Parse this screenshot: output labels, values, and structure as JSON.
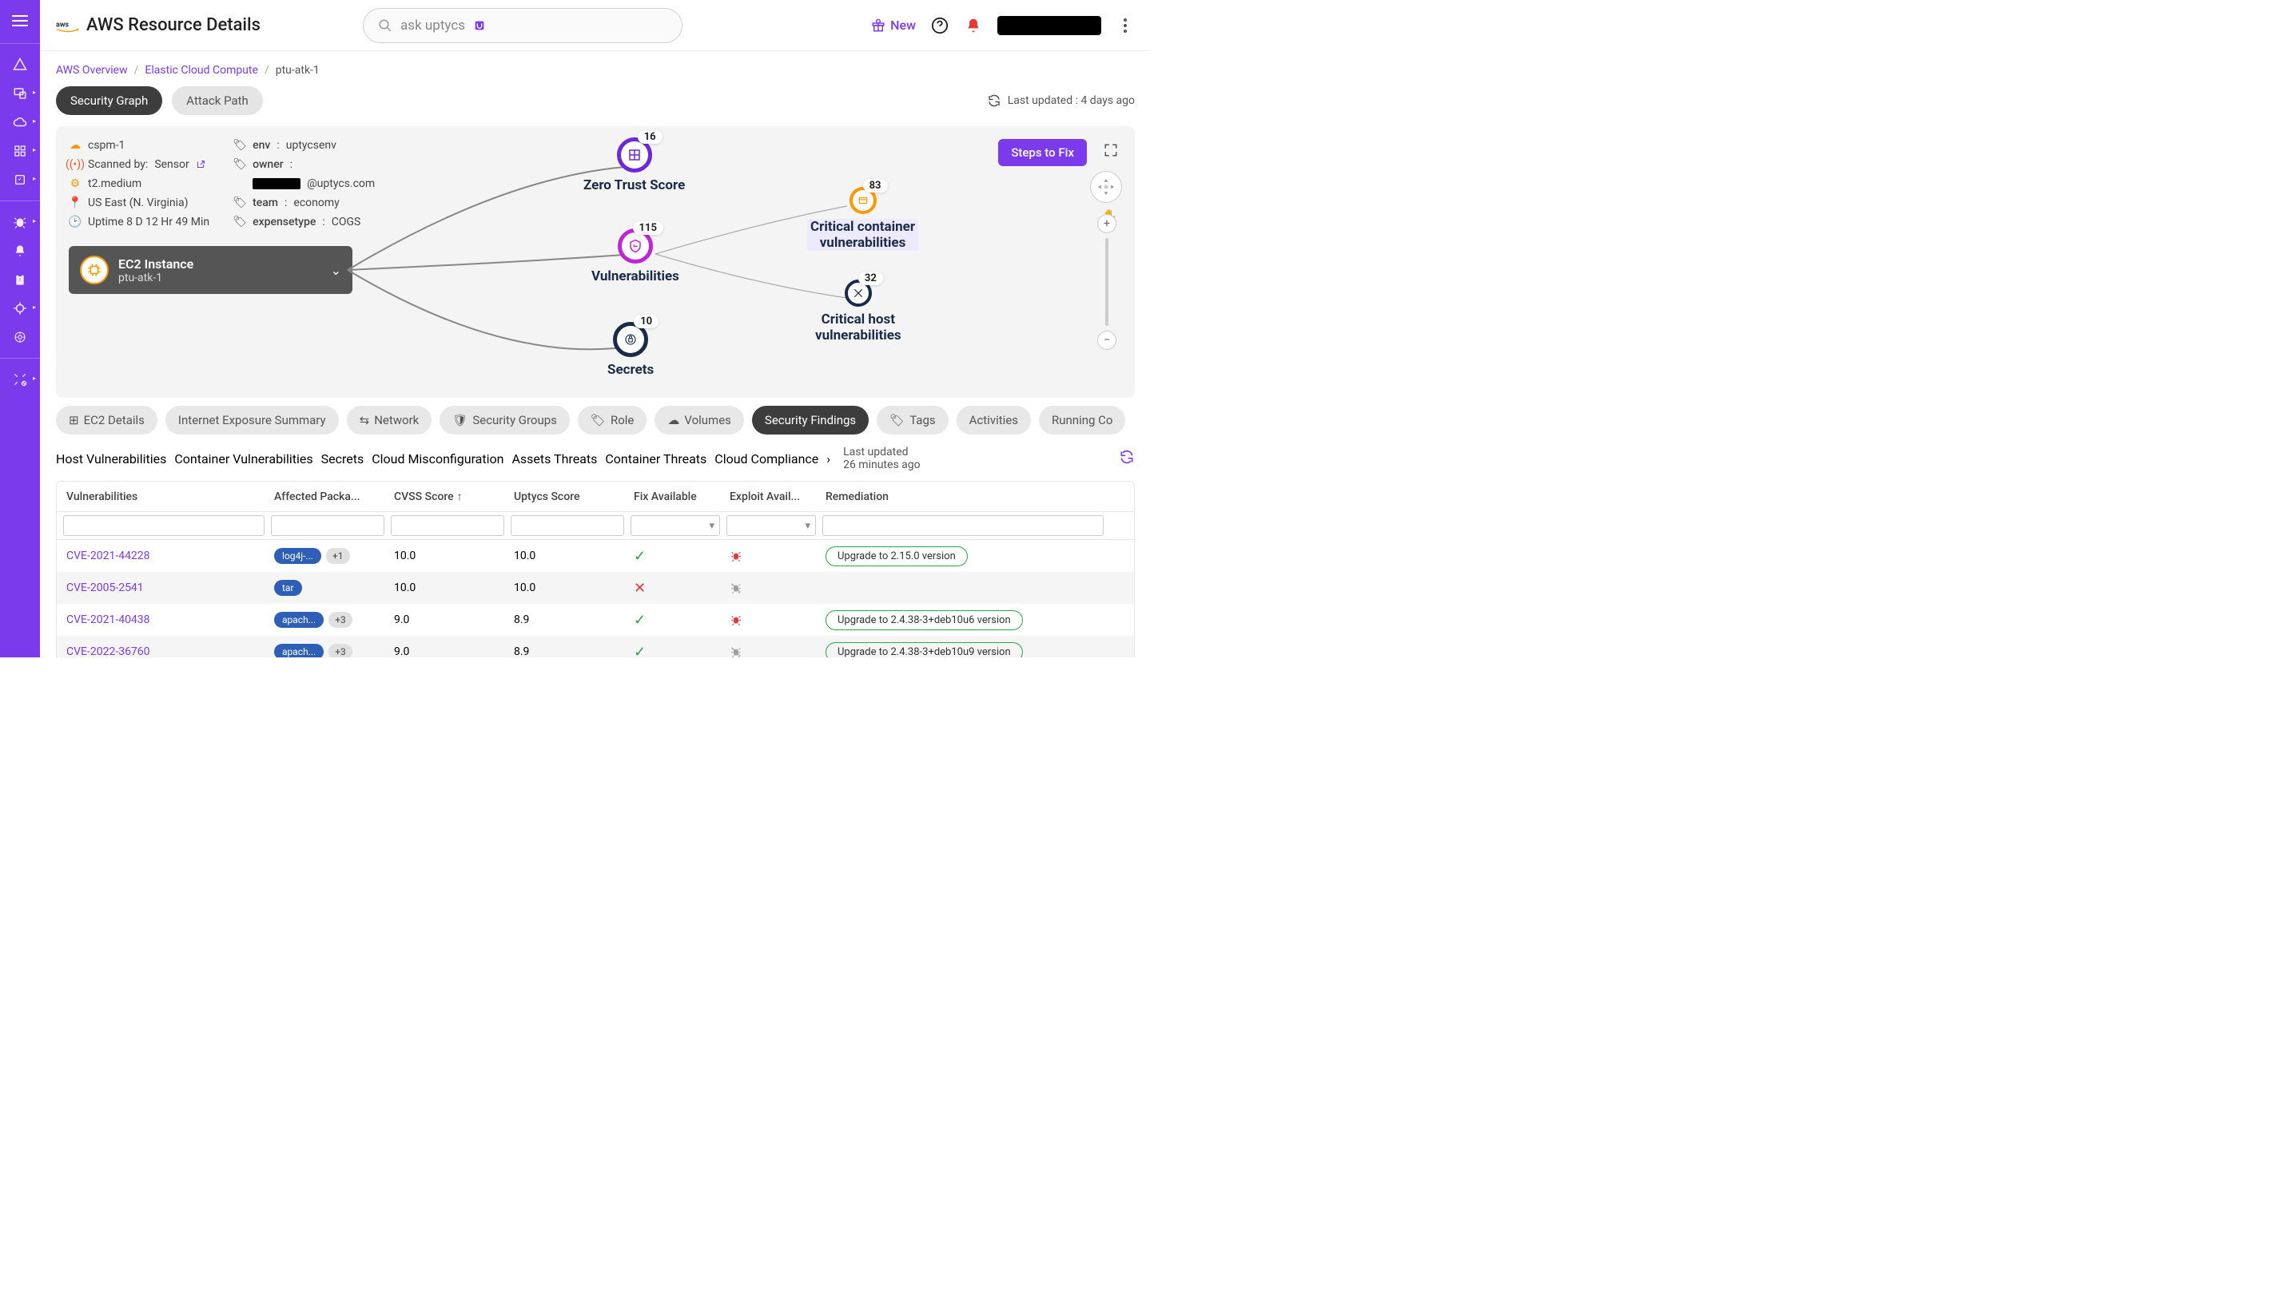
{
  "header": {
    "page_title": "AWS Resource Details",
    "search_placeholder": "ask uptycs",
    "new_label": "New"
  },
  "breadcrumb": {
    "root": "AWS Overview",
    "mid": "Elastic Cloud Compute",
    "current": "ptu-atk-1"
  },
  "view_tabs": {
    "security_graph": "Security Graph",
    "attack_path": "Attack Path"
  },
  "last_updated": "Last updated : 4 days ago",
  "meta": {
    "account": "cspm-1",
    "scanned_by_label": "Scanned by:",
    "scanned_by": "Sensor",
    "instance_type": "t2.medium",
    "region": "US East (N. Virginia)",
    "uptime": "Uptime 8 D 12 Hr 49 Min",
    "tags": {
      "env_k": "env",
      "env_v": "uptycsenv",
      "owner_k": "owner",
      "owner_suffix": "@uptycs.com",
      "team_k": "team",
      "team_v": "economy",
      "exp_k": "expensetype",
      "exp_v": "COGS"
    }
  },
  "ec2_card": {
    "type": "EC2 Instance",
    "name": "ptu-atk-1"
  },
  "steps_btn": "Steps to Fix",
  "graph": {
    "zero_trust": {
      "label": "Zero Trust Score",
      "count": "16"
    },
    "vulns": {
      "label": "Vulnerabilities",
      "count": "115"
    },
    "secrets": {
      "label": "Secrets",
      "count": "10"
    },
    "crit_container": {
      "label1": "Critical container",
      "label2": "vulnerabilities",
      "count": "83"
    },
    "crit_host": {
      "label1": "Critical host",
      "label2": "vulnerabilities",
      "count": "32"
    }
  },
  "tabs1": [
    "EC2 Details",
    "Internet Exposure Summary",
    "Network",
    "Security Groups",
    "Role",
    "Volumes",
    "Security Findings",
    "Tags",
    "Activities",
    "Running Co"
  ],
  "tabs1_active": "Security Findings",
  "tabs2": [
    "Host Vulnerabilities",
    "Container Vulnerabilities",
    "Secrets",
    "Cloud Misconfiguration",
    "Assets Threats",
    "Container Threats",
    "Cloud Compliance"
  ],
  "tabs2_active": "Container Vulnerabilities",
  "last_updated2": "Last updated 26 minutes ago",
  "table": {
    "headers": {
      "v": "Vulnerabilities",
      "p": "Affected Packa...",
      "c": "CVSS Score",
      "u": "Uptycs Score",
      "f": "Fix Available",
      "e": "Exploit Avail...",
      "r": "Remediation"
    },
    "rows": [
      {
        "cve": "CVE-2021-44228",
        "pkg": "log4j-...",
        "plus": "+1",
        "cvss": "10.0",
        "uscore": "10.0",
        "fix": true,
        "exploit": "red",
        "remed": "Upgrade to 2.15.0 version"
      },
      {
        "cve": "CVE-2005-2541",
        "pkg": "tar",
        "plus": "",
        "cvss": "10.0",
        "uscore": "10.0",
        "fix": false,
        "exploit": "gray",
        "remed": ""
      },
      {
        "cve": "CVE-2021-40438",
        "pkg": "apach...",
        "plus": "+3",
        "cvss": "9.0",
        "uscore": "8.9",
        "fix": true,
        "exploit": "red",
        "remed": "Upgrade to 2.4.38-3+deb10u6 version"
      },
      {
        "cve": "CVE-2022-36760",
        "pkg": "apach...",
        "plus": "+3",
        "cvss": "9.0",
        "uscore": "8.9",
        "fix": true,
        "exploit": "gray",
        "remed": "Upgrade to 2.4.38-3+deb10u9 version"
      }
    ]
  }
}
